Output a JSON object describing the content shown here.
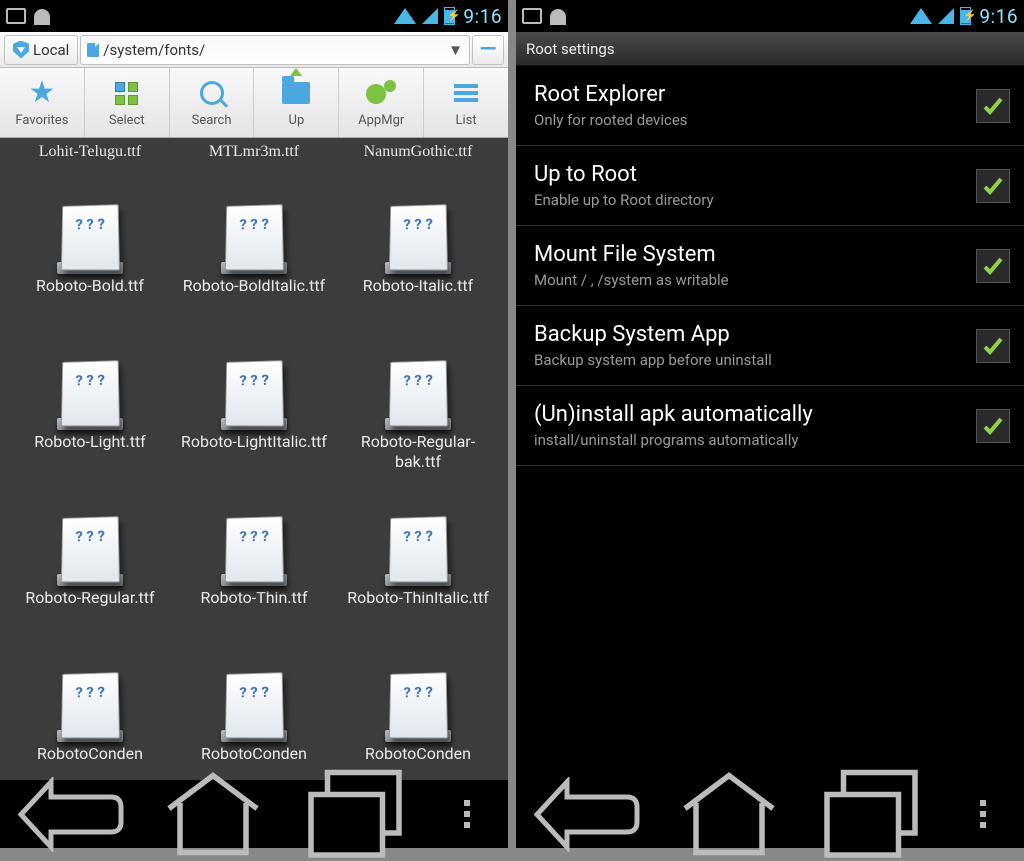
{
  "statusbar": {
    "time": "9:16"
  },
  "fb": {
    "local_label": "Local",
    "path": "/system/fonts/",
    "toolbar": {
      "favorites": "Favorites",
      "select": "Select",
      "search": "Search",
      "up": "Up",
      "appmgr": "AppMgr",
      "list": "List"
    },
    "files": [
      {
        "name": "Lohit-Telugu.ttf",
        "row": 0
      },
      {
        "name": "MTLmr3m.ttf",
        "row": 0
      },
      {
        "name": "NanumGothic.ttf",
        "row": 0
      },
      {
        "name": "Roboto-Bold.ttf",
        "row": 1
      },
      {
        "name": "Roboto-BoldItalic.ttf",
        "row": 1
      },
      {
        "name": "Roboto-Italic.ttf",
        "row": 1
      },
      {
        "name": "Roboto-Light.ttf",
        "row": 2
      },
      {
        "name": "Roboto-LightItalic.ttf",
        "row": 2
      },
      {
        "name": "Roboto-Regular-bak.ttf",
        "row": 2
      },
      {
        "name": "Roboto-Regular.ttf",
        "row": 3
      },
      {
        "name": "Roboto-Thin.ttf",
        "row": 3
      },
      {
        "name": "Roboto-ThinItalic.ttf",
        "row": 3
      },
      {
        "name": "RobotoConden",
        "row": 4
      },
      {
        "name": "RobotoConden",
        "row": 4
      },
      {
        "name": "RobotoConden",
        "row": 4
      }
    ]
  },
  "settings": {
    "header": "Root settings",
    "items": [
      {
        "title": "Root Explorer",
        "sub": "Only for rooted devices",
        "checked": true
      },
      {
        "title": "Up to Root",
        "sub": "Enable up to Root directory",
        "checked": true
      },
      {
        "title": "Mount File System",
        "sub": "Mount / , /system as writable",
        "checked": true
      },
      {
        "title": "Backup System App",
        "sub": "Backup system app before uninstall",
        "checked": true
      },
      {
        "title": "(Un)install apk automatically",
        "sub": "install/uninstall programs automatically",
        "checked": true
      }
    ]
  }
}
